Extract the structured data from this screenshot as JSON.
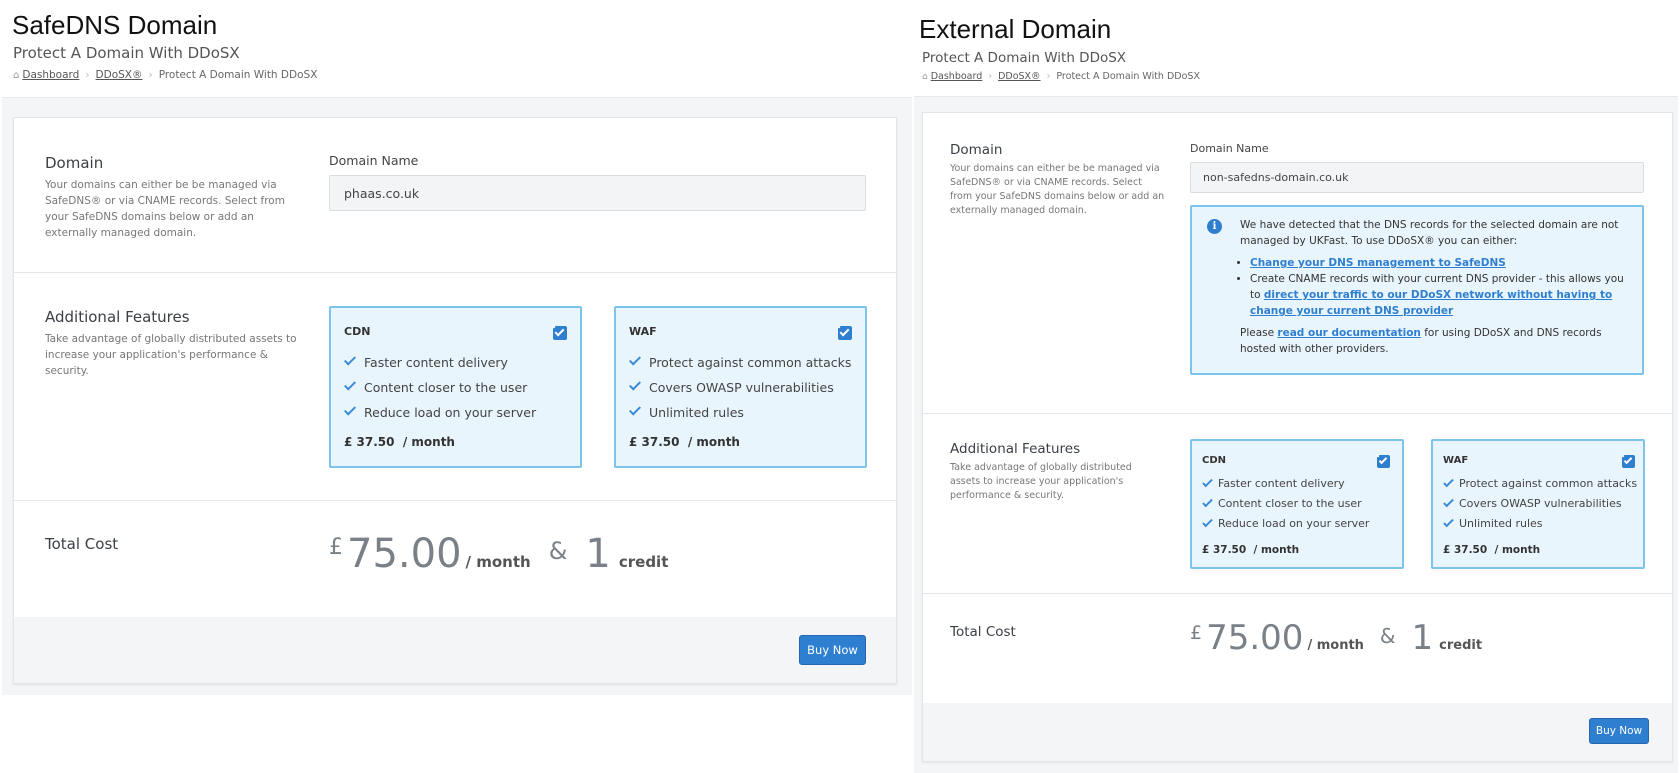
{
  "left": {
    "big_label": "SafeDNS Domain",
    "page_title": "Protect A Domain With DDoSX",
    "breadcrumb": [
      "Dashboard",
      "DDoSX®",
      "Protect A Domain With DDoSX"
    ],
    "domain_section": {
      "title": "Domain",
      "desc": "Your domains can either be be managed via SafeDNS® or via CNAME records. Select from your SafeDNS domains below or add an externally managed domain.",
      "field_label": "Domain Name",
      "field_value": "phaas.co.uk"
    },
    "features_section": {
      "title": "Additional Features",
      "desc": "Take advantage of globally distributed assets to increase your application's performance & security.",
      "cards": [
        {
          "name": "CDN",
          "checked": true,
          "items": [
            "Faster content delivery",
            "Content closer to the user",
            "Reduce load on your server"
          ],
          "price": "£ 37.50",
          "per": "/ month"
        },
        {
          "name": "WAF",
          "checked": true,
          "items": [
            "Protect against common attacks",
            "Covers OWASP vulnerabilities",
            "Unlimited rules"
          ],
          "price": "£ 37.50",
          "per": "/ month"
        }
      ]
    },
    "total": {
      "title": "Total Cost",
      "currency": "£",
      "amount": "75.00",
      "per": "/ month",
      "amp": "&",
      "credits": "1",
      "credit_label": "credit"
    },
    "buy_label": "Buy Now"
  },
  "right": {
    "big_label": "External Domain",
    "page_title": "Protect A Domain With DDoSX",
    "breadcrumb": [
      "Dashboard",
      "DDoSX®",
      "Protect A Domain With DDoSX"
    ],
    "domain_section": {
      "title": "Domain",
      "desc": "Your domains can either be be managed via SafeDNS® or via CNAME records. Select from your SafeDNS domains below or add an externally managed domain.",
      "field_label": "Domain Name",
      "field_value": "non-safedns-domain.co.uk"
    },
    "alert": {
      "intro": "We have detected that the DNS records for the selected domain are not managed by UKFast. To use DDoSX® you can either:",
      "option1_link": "Change your DNS management to SafeDNS",
      "option2_text": "Create CNAME records with your current DNS provider - this allows you to",
      "option2_link": "direct your traffic to our DDoSX network without having to change your current DNS provider",
      "footer_pre": "Please",
      "footer_link": "read our documentation",
      "footer_post": "for using DDoSX and DNS records hosted with other providers."
    },
    "features_section": {
      "title": "Additional Features",
      "desc": "Take advantage of globally distributed assets to increase your application's performance & security.",
      "cards": [
        {
          "name": "CDN",
          "checked": true,
          "items": [
            "Faster content delivery",
            "Content closer to the user",
            "Reduce load on your server"
          ],
          "price": "£ 37.50",
          "per": "/ month"
        },
        {
          "name": "WAF",
          "checked": true,
          "items": [
            "Protect against common attacks",
            "Covers OWASP vulnerabilities",
            "Unlimited rules"
          ],
          "price": "£ 37.50",
          "per": "/ month"
        }
      ]
    },
    "total": {
      "title": "Total Cost",
      "currency": "£",
      "amount": "75.00",
      "per": "/ month",
      "amp": "&",
      "credits": "1",
      "credit_label": "credit"
    },
    "buy_label": "Buy Now"
  },
  "colors": {
    "accent": "#2f7fd1",
    "card_border": "#7cc4ec",
    "card_bg": "#e9f5fc"
  }
}
